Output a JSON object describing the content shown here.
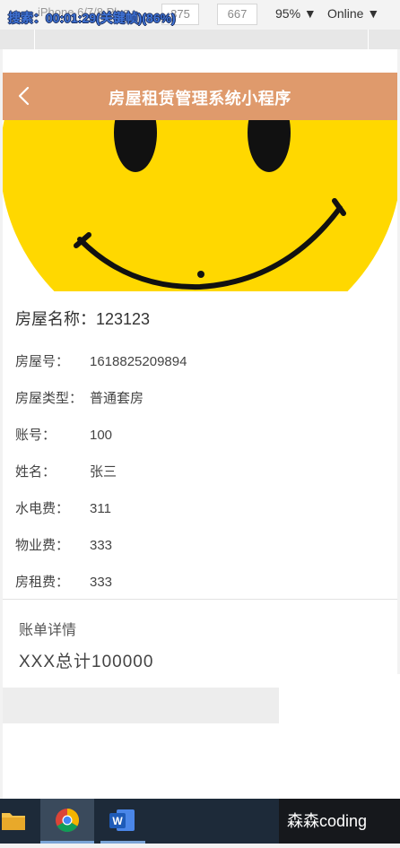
{
  "devtools": {
    "device": "iPhone 6/7/8 Plus",
    "width": "375",
    "height": "667",
    "zoom": "95% ▼",
    "network": "Online ▼",
    "overlay_text": "搜索：00:01:29(关键帧)(86%)"
  },
  "navbar": {
    "title": "房屋租赁管理系统小程序",
    "back_icon": "chevron-left-icon"
  },
  "house": {
    "name_label": "房屋名称：",
    "name_value": "123123",
    "fields": [
      {
        "label": "房屋号：",
        "value": "1618825209894"
      },
      {
        "label": "房屋类型：",
        "value": "普通套房"
      },
      {
        "label": "账号：",
        "value": "100"
      },
      {
        "label": "姓名：",
        "value": "张三"
      },
      {
        "label": "水电费：",
        "value": "311"
      },
      {
        "label": "物业费：",
        "value": "333"
      },
      {
        "label": "房租费：",
        "value": "333"
      }
    ]
  },
  "bill": {
    "title": "账单详情",
    "total": "XXX总计100000"
  },
  "watermark": "森森coding",
  "colors": {
    "navbar": "#df9a6c",
    "smiley": "#ffd800",
    "pink_button": "#f59aa8"
  }
}
